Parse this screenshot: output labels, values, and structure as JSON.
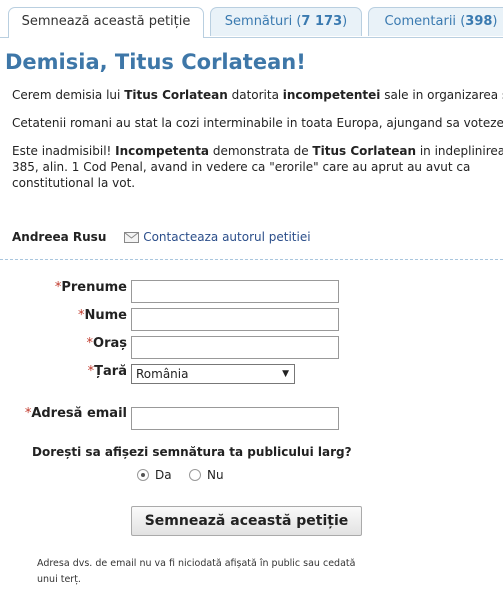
{
  "tabs": [
    {
      "label": "Semnează această petiție",
      "count": ""
    },
    {
      "label": "Semnături",
      "count": "7 173"
    },
    {
      "label": "Comentarii",
      "count": "398"
    }
  ],
  "title": "Demisia, Titus Corlatean!",
  "paragraphs": {
    "p1": {
      "a": "Cerem demisia lui ",
      "b": "Titus Corlatean",
      "c": " datorita ",
      "d": "incompetentei",
      "e": " sale in organizarea se"
    },
    "p2": "Cetatenii romani au stat la cozi interminabile in toata Europa, ajungand sa voteze",
    "p3": {
      "a": "Este inadmisibil! ",
      "b": "Incompetenta",
      "c": " demonstrata de ",
      "d": "Titus Corlatean",
      "e": " in indeplinirea",
      "line2": "385, alin. 1 Cod Penal, avand in vedere ca \"erorile\" care au aprut au avut ca",
      "line3": "constitutional la vot."
    }
  },
  "author": {
    "name": "Andreea Rusu",
    "contact_label": "Contacteaza autorul petitiei"
  },
  "form": {
    "required_mark": "*",
    "first_name_label": "Prenume",
    "last_name_label": "Nume",
    "city_label": "Oraș",
    "country_label": "Țară",
    "country_value": "România",
    "email_label": "Adresă email",
    "public_question": "Dorești sa afișezi semnătura ta publicului larg?",
    "option_yes": "Da",
    "option_no": "Nu",
    "selected": "Da",
    "submit_label": "Semnează această petiție",
    "note": "Adresa dvs. de email nu va fi niciodată afișată în public sau cedată unui terț."
  },
  "icons": {
    "contact": "envelope-icon",
    "dropdown": "triangle-down-icon"
  },
  "colors": {
    "title": "#3e77a8",
    "link": "#2b4e8a",
    "tab_bg": "#e9f2f8",
    "required": "#c0392b"
  }
}
